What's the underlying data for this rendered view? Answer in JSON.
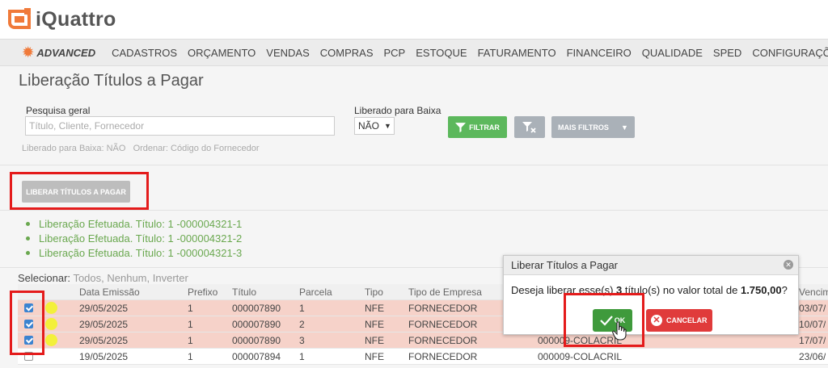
{
  "app": {
    "logo_text": "iQuattro",
    "brand": "ADVANCED",
    "accent": "#f07a3a"
  },
  "nav": [
    "CADASTROS",
    "ORÇAMENTO",
    "VENDAS",
    "COMPRAS",
    "PCP",
    "ESTOQUE",
    "FATURAMENTO",
    "FINANCEIRO",
    "QUALIDADE",
    "SPED",
    "CONFIGURAÇÕES"
  ],
  "page": {
    "title": "Liberação Títulos a Pagar"
  },
  "filters": {
    "search_label": "Pesquisa geral",
    "search_placeholder": "Título, Cliente, Fornecedor",
    "liberado_label": "Liberado para Baixa",
    "liberado_value": "NÃO",
    "filtrar_label": "FILTRAR",
    "more_label": "MAIS FILTROS",
    "info": "Liberado para Baixa: NÃO   Ordenar: Código do Fornecedor"
  },
  "actions": {
    "liberar_label": "LIBERAR TÍTULOS A PAGAR"
  },
  "messages": [
    "Liberação Efetuada. Título: 1 -000004321-1",
    "Liberação Efetuada. Título: 1 -000004321-2",
    "Liberação Efetuada. Título: 1 -000004321-3"
  ],
  "select": {
    "lead": "Selecionar:",
    "all": "Todos",
    "none": "Nenhum",
    "invert": "Inverter"
  },
  "table": {
    "headers": [
      "Data Emissão",
      "Prefixo",
      "Título",
      "Parcela",
      "Tipo",
      "Tipo de Empresa",
      "",
      "Vencim"
    ],
    "rows": [
      {
        "checked": true,
        "data": "29/05/2025",
        "prefixo": "1",
        "titulo": "000007890",
        "parcela": "1",
        "tipo": "NFE",
        "empresa": "FORNECEDOR",
        "nome": "",
        "venc": "03/07/"
      },
      {
        "checked": true,
        "data": "29/05/2025",
        "prefixo": "1",
        "titulo": "000007890",
        "parcela": "2",
        "tipo": "NFE",
        "empresa": "FORNECEDOR",
        "nome": "",
        "venc": "10/07/"
      },
      {
        "checked": true,
        "data": "29/05/2025",
        "prefixo": "1",
        "titulo": "000007890",
        "parcela": "3",
        "tipo": "NFE",
        "empresa": "FORNECEDOR",
        "nome": "000009-COLACRIL",
        "venc": "17/07/"
      },
      {
        "checked": false,
        "data": "19/05/2025",
        "prefixo": "1",
        "titulo": "000007894",
        "parcela": "1",
        "tipo": "NFE",
        "empresa": "FORNECEDOR",
        "nome": "000009-COLACRIL",
        "venc": "23/06/"
      }
    ]
  },
  "dialog": {
    "title": "Liberar Títulos a Pagar",
    "msg_pre": "Deseja liberar esse(s) ",
    "count": "3",
    "msg_mid": " título(s) no valor total de ",
    "total": "1.750,00",
    "msg_post": "?",
    "ok_label": "OK",
    "cancel_label": "CANCELAR"
  }
}
